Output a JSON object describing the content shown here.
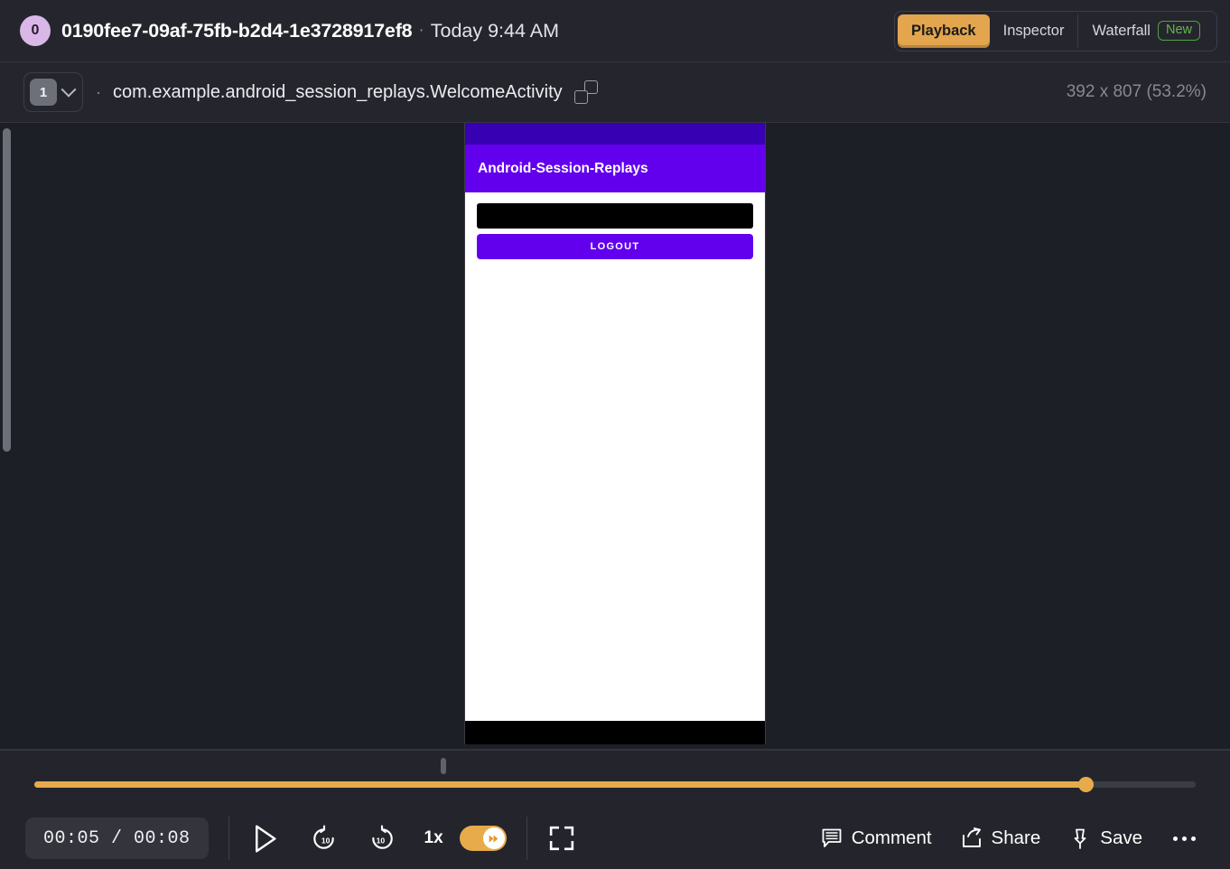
{
  "header": {
    "avatar_initial": "0",
    "session_id": "0190fee7-09af-75fb-b2d4-1e3728917ef8",
    "separator": "·",
    "date": "Today 9:44 AM",
    "tabs": [
      {
        "label": "Playback",
        "active": true
      },
      {
        "label": "Inspector",
        "active": false
      },
      {
        "label": "Waterfall",
        "active": false,
        "badge": "New"
      }
    ],
    "accent_color": "#e3a54d",
    "badge_color": "#66b34f"
  },
  "subheader": {
    "segment_number": "1",
    "chevron_icon": "chevron-down-icon",
    "separator": "·",
    "activity_name": "com.example.android_session_replays.WelcomeActivity",
    "copy_icon": "copy-icon",
    "resolution": "392 x 807 (53.2%)"
  },
  "replay": {
    "app_title": "Android-Session-Replays",
    "logout_label": "LOGOUT",
    "status_bar_color": "#3700b3",
    "app_bar_color": "#6200ee",
    "masked_field_color": "#000000",
    "nav_bar_color": "#000000"
  },
  "playbar": {
    "current_time": "00:05",
    "time_divider": "/",
    "total_time": "00:08",
    "time_display": "00:05 / 00:08",
    "progress_percent": 90.5,
    "buffer_percent": 6.5,
    "event_marker_percent": 35,
    "play_icon": "play-icon",
    "rewind_icon": "rewind-10-icon",
    "forward_icon": "forward-10-icon",
    "rewind_seconds": "10",
    "forward_seconds": "10",
    "speed_label": "1x",
    "skip_inactivity_on": true,
    "skip_inactivity_icon": "fast-forward-icon",
    "fullscreen_icon": "fullscreen-icon",
    "actions": [
      {
        "label": "Comment",
        "icon": "comment-icon"
      },
      {
        "label": "Share",
        "icon": "share-icon"
      },
      {
        "label": "Save",
        "icon": "pin-icon"
      }
    ],
    "more_icon": "ellipsis-icon"
  }
}
